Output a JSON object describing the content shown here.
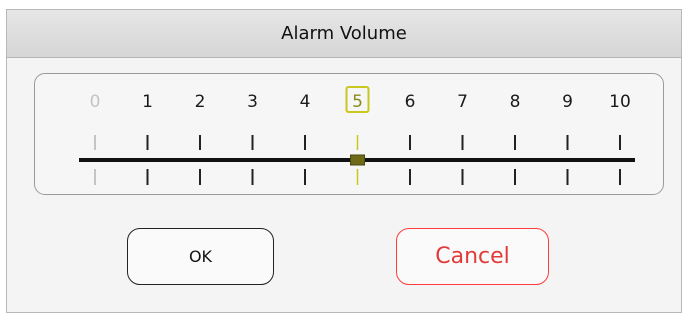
{
  "dialog": {
    "title": "Alarm Volume"
  },
  "slider": {
    "min": 0,
    "max": 10,
    "value": 5,
    "tick_labels": [
      "0",
      "1",
      "2",
      "3",
      "4",
      "5",
      "6",
      "7",
      "8",
      "9",
      "10"
    ],
    "disabled_values": [
      0
    ],
    "colors": {
      "track": "#111111",
      "tick": "#222222",
      "disabled": "#c4c4c4",
      "selected_outline": "#c8c81e",
      "handle": "#6e6a16"
    }
  },
  "buttons": {
    "ok_label": "OK",
    "cancel_label": "Cancel",
    "cancel_color": "#e23a3a"
  }
}
